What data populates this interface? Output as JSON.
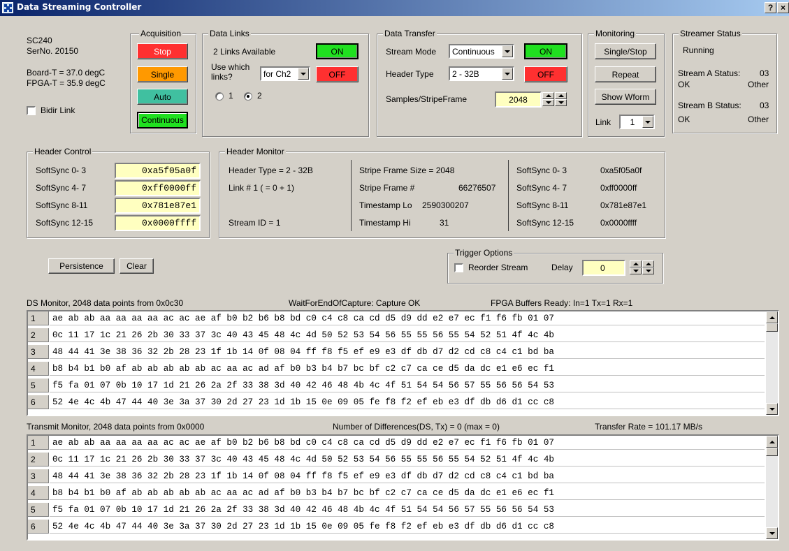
{
  "window": {
    "title": "Data Streaming Controller",
    "help_label": "?",
    "close_label": "×"
  },
  "info": {
    "model": "SC240",
    "serial": "SerNo. 20150",
    "board_temp": "Board-T = 37.0 degC",
    "fpga_temp": "FPGA-T = 35.9 degC",
    "bidir_label": "Bidir Link",
    "bidir_checked": false
  },
  "acquisition": {
    "title": "Acquisition",
    "stop_label": "Stop",
    "single_label": "Single",
    "auto_label": "Auto",
    "continuous_label": "Continuous"
  },
  "data_links": {
    "title": "Data Links",
    "available": "2 Links Available",
    "on_label": "ON",
    "off_label": "OFF",
    "use_which_label": "Use which links?",
    "use_which_value": "for Ch2",
    "radio_1_label": "1",
    "radio_2_label": "2",
    "selected_radio": "2"
  },
  "data_transfer": {
    "title": "Data Transfer",
    "stream_mode_label": "Stream Mode",
    "stream_mode_value": "Continuous",
    "header_type_label": "Header Type",
    "header_type_value": "2 - 32B",
    "on_label": "ON",
    "off_label": "OFF",
    "samples_label": "Samples/StripeFrame",
    "samples_value": "2048"
  },
  "monitoring": {
    "title": "Monitoring",
    "single_stop_label": "Single/Stop",
    "repeat_label": "Repeat",
    "show_wform_label": "Show Wform",
    "link_label": "Link",
    "link_value": "1"
  },
  "streamer_status": {
    "title": "Streamer Status",
    "state": "Running",
    "stream_a_label": "Stream A Status:",
    "stream_a_code": "03",
    "stream_a_ok": "OK",
    "stream_a_other": "Other",
    "stream_b_label": "Stream B Status:",
    "stream_b_code": "03",
    "stream_b_ok": "OK",
    "stream_b_other": "Other"
  },
  "header_control": {
    "title": "Header Control",
    "rows": [
      {
        "label": "SoftSync  0- 3",
        "value": "0xa5f05a0f"
      },
      {
        "label": "SoftSync  4- 7",
        "value": "0xff0000ff"
      },
      {
        "label": "SoftSync  8-11",
        "value": "0x781e87e1"
      },
      {
        "label": "SoftSync 12-15",
        "value": "0x0000ffff"
      }
    ]
  },
  "header_monitor": {
    "title": "Header Monitor",
    "header_type": "Header Type =  2 - 32B",
    "link": "Link # 1  ( = 0 + 1)",
    "stream_id": "Stream ID =  1",
    "stripe_size": "Stripe Frame Size = 2048",
    "stripe_num_label": "Stripe Frame #",
    "stripe_num_value": "66276507",
    "ts_lo_label": "Timestamp Lo",
    "ts_lo_value": "2590300207",
    "ts_hi_label": "Timestamp Hi",
    "ts_hi_value": "31",
    "softsync_rows": [
      {
        "label": "SoftSync  0- 3",
        "value": "0xa5f05a0f"
      },
      {
        "label": "SoftSync  4- 7",
        "value": "0xff0000ff"
      },
      {
        "label": "SoftSync  8-11",
        "value": "0x781e87e1"
      },
      {
        "label": "SoftSync 12-15",
        "value": "0x0000ffff"
      }
    ]
  },
  "buttons": {
    "persistence_label": "Persistence",
    "clear_label": "Clear"
  },
  "trigger": {
    "title": "Trigger Options",
    "reorder_label": "Reorder Stream",
    "reorder_checked": false,
    "delay_label": "Delay",
    "delay_value": "0"
  },
  "ds_monitor": {
    "title": "DS Monitor,   2048 data points from 0x0c30",
    "wait_text": "WaitForEndOfCapture: Capture OK",
    "buffers_text": "FPGA Buffers Ready: In=1  Tx=1  Rx=1",
    "rows": [
      {
        "n": "1",
        "data": "ae ab ab aa aa aa aa ac ac ae af b0 b2 b6 b8 bd c0 c4 c8 ca cd d5 d9 dd e2 e7 ec f1 f6 fb 01 07"
      },
      {
        "n": "2",
        "data": "0c 11 17 1c 21 26 2b 30 33 37 3c 40 43 45 48 4c 4d 50 52 53 54 56 55 55 56 55 54 52 51 4f 4c 4b"
      },
      {
        "n": "3",
        "data": "48 44 41 3e 38 36 32 2b 28 23 1f 1b 14 0f 08 04 ff f8 f5 ef e9 e3 df db d7 d2 cd c8 c4 c1 bd ba"
      },
      {
        "n": "4",
        "data": "b8 b4 b1 b0 af ab ab ab ab ab ac aa ac ad af b0 b3 b4 b7 bc bf c2 c7 ca ce d5 da dc e1 e6 ec f1"
      },
      {
        "n": "5",
        "data": "f5 fa 01 07 0b 10 17 1d 21 26 2a 2f 33 38 3d 40 42 46 48 4b 4c 4f 51 54 54 56 57 55 56 56 54 53"
      },
      {
        "n": "6",
        "data": "52 4e 4c 4b 47 44 40 3e 3a 37 30 2d 27 23 1d 1b 15 0e 09 05 fe f8 f2 ef eb e3 df db d6 d1 cc c8"
      }
    ]
  },
  "tx_monitor": {
    "title": "Transmit Monitor,   2048 data points from 0x0000",
    "diff_text": "Number of Differences(DS, Tx) = 0 (max = 0)",
    "rate_text": "Transfer Rate = 101.17 MB/s",
    "rows": [
      {
        "n": "1",
        "data": "ae ab ab aa aa aa aa ac ac ae af b0 b2 b6 b8 bd c0 c4 c8 ca cd d5 d9 dd e2 e7 ec f1 f6 fb 01 07"
      },
      {
        "n": "2",
        "data": "0c 11 17 1c 21 26 2b 30 33 37 3c 40 43 45 48 4c 4d 50 52 53 54 56 55 55 56 55 54 52 51 4f 4c 4b"
      },
      {
        "n": "3",
        "data": "48 44 41 3e 38 36 32 2b 28 23 1f 1b 14 0f 08 04 ff f8 f5 ef e9 e3 df db d7 d2 cd c8 c4 c1 bd ba"
      },
      {
        "n": "4",
        "data": "b8 b4 b1 b0 af ab ab ab ab ab ac aa ac ad af b0 b3 b4 b7 bc bf c2 c7 ca ce d5 da dc e1 e6 ec f1"
      },
      {
        "n": "5",
        "data": "f5 fa 01 07 0b 10 17 1d 21 26 2a 2f 33 38 3d 40 42 46 48 4b 4c 4f 51 54 54 56 57 55 56 56 54 53"
      },
      {
        "n": "6",
        "data": "52 4e 4c 4b 47 44 40 3e 3a 37 30 2d 27 23 1d 1b 15 0e 09 05 fe f8 f2 ef eb e3 df db d6 d1 cc c8"
      }
    ]
  },
  "colors": {
    "stop": "#ff3030",
    "single": "#ff9900",
    "auto": "#40c0a0",
    "on": "#20e020",
    "input_bg": "#ffffc0",
    "face": "#d4d0c8"
  }
}
